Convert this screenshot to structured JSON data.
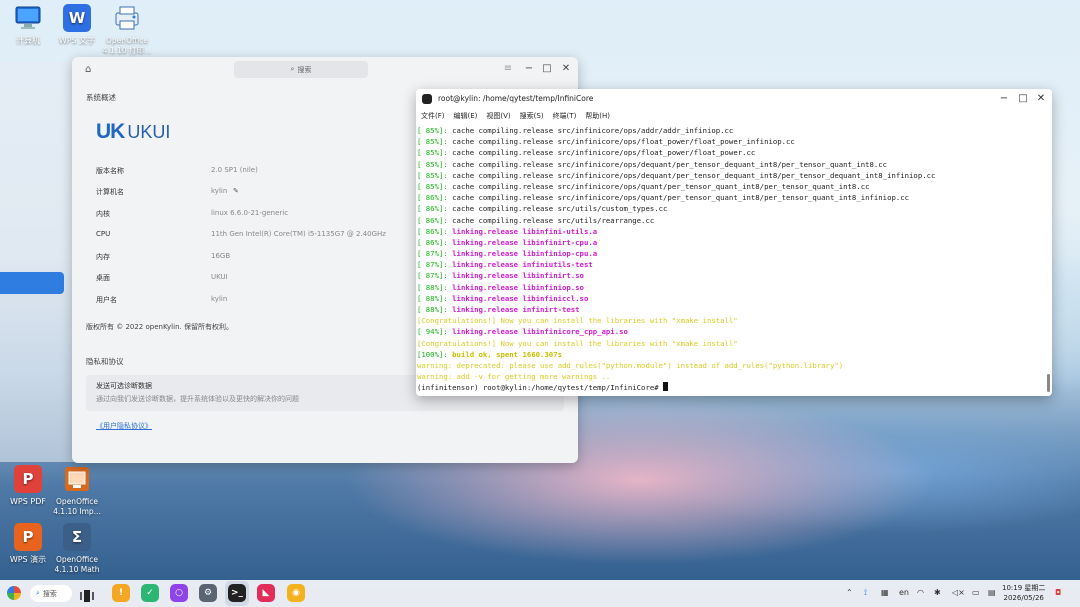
{
  "desktop": {
    "icons_top": [
      {
        "label": "计算机",
        "icon": "computer-icon",
        "color": "#2f7de1"
      },
      {
        "label": "WPS 文字",
        "icon": "wps-writer-icon",
        "color": "#2f6fe4",
        "glyph": "W"
      },
      {
        "label": "OpenOffice 4.1.10 打印...",
        "icon": "openoffice-printer-icon",
        "color": "#3a86d8"
      }
    ],
    "icons_bottom": [
      {
        "label": "WPS PDF",
        "icon": "wps-pdf-icon",
        "color": "#e0423b",
        "glyph": "P"
      },
      {
        "label": "OpenOffice 4.1.10 Imp...",
        "icon": "openoffice-impress-icon",
        "color": "#d86a1e"
      },
      {
        "label": "WPS 演示",
        "icon": "wps-presentation-icon",
        "color": "#e8641e",
        "glyph": "P"
      },
      {
        "label": "OpenOffice 4.1.10 Math",
        "icon": "openoffice-math-icon",
        "color": "#3c5f8a",
        "glyph": "Σ"
      }
    ]
  },
  "settings": {
    "search_placeholder": "搜索",
    "section_overview": "系统概述",
    "logo_mark": "UK",
    "logo_text": "UKUI",
    "rows": [
      {
        "key": "版本名称",
        "value": "2.0 SP1 (nile)"
      },
      {
        "key": "计算机名",
        "value": "kylin"
      },
      {
        "key": "内核",
        "value": "linux 6.6.0-21-generic"
      },
      {
        "key": "CPU",
        "value": "11th Gen Intel(R) Core(TM) i5-1135G7 @ 2.40GHz"
      },
      {
        "key": "内存",
        "value": "16GB"
      },
      {
        "key": "桌面",
        "value": "UKUI"
      },
      {
        "key": "用户名",
        "value": "kylin"
      }
    ],
    "copyright": "版权所有 © 2022 openKylin. 保留所有权利。",
    "section_privacy": "隐私和协议",
    "diag_title": "发送可选诊断数据",
    "diag_desc": "通过向我们发送诊断数据，提升系统体验以及更快的解决你的问题",
    "policy_link": "《用户隐私协议》"
  },
  "terminal": {
    "title": "root@kylin: /home/qytest/temp/InfiniCore",
    "menu": [
      "文件(F)",
      "编辑(E)",
      "视图(V)",
      "搜索(S)",
      "终端(T)",
      "帮助(H)"
    ],
    "lines": [
      {
        "type": "cache",
        "pct": "[ 85%]:",
        "text": " cache compiling.release src/infinicore/ops/addr/addr_infiniop.cc"
      },
      {
        "type": "cache",
        "pct": "[ 85%]:",
        "text": " cache compiling.release src/infinicore/ops/float_power/float_power_infiniop.cc"
      },
      {
        "type": "cache",
        "pct": "[ 85%]:",
        "text": " cache compiling.release src/infinicore/ops/float_power/float_power.cc"
      },
      {
        "type": "cache",
        "pct": "[ 85%]:",
        "text": " cache compiling.release src/infinicore/ops/dequant/per_tensor_dequant_int8/per_tensor_quant_int8.cc"
      },
      {
        "type": "cache",
        "pct": "[ 85%]:",
        "text": " cache compiling.release src/infinicore/ops/dequant/per_tensor_dequant_int8/per_tensor_dequant_int8_infiniop.cc"
      },
      {
        "type": "cache",
        "pct": "[ 85%]:",
        "text": " cache compiling.release src/infinicore/ops/quant/per_tensor_quant_int8/per_tensor_quant_int8.cc"
      },
      {
        "type": "cache",
        "pct": "[ 86%]:",
        "text": " cache compiling.release src/infinicore/ops/quant/per_tensor_quant_int8/per_tensor_quant_int8_infiniop.cc"
      },
      {
        "type": "cache",
        "pct": "[ 86%]:",
        "text": " cache compiling.release src/utils/custom_types.cc"
      },
      {
        "type": "cache",
        "pct": "[ 86%]:",
        "text": " cache compiling.release src/utils/rearrange.cc"
      },
      {
        "type": "link",
        "pct": "[ 86%]:",
        "text": " linking.release libinfini-utils.a"
      },
      {
        "type": "link",
        "pct": "[ 86%]:",
        "text": " linking.release libinfinirt-cpu.a"
      },
      {
        "type": "link",
        "pct": "[ 87%]:",
        "text": " linking.release libinfiniop-cpu.a"
      },
      {
        "type": "link",
        "pct": "[ 87%]:",
        "text": " linking.release infiniutils-test"
      },
      {
        "type": "link",
        "pct": "[ 87%]:",
        "text": " linking.release libinfinirt.so"
      },
      {
        "type": "link",
        "pct": "[ 88%]:",
        "text": " linking.release libinfiniop.so"
      },
      {
        "type": "link",
        "pct": "[ 88%]:",
        "text": " linking.release libinfiniccl.so"
      },
      {
        "type": "link",
        "pct": "[ 88%]:",
        "text": " linking.release infinirt-test"
      },
      {
        "type": "congrats",
        "pct": "",
        "text": "[Congratulations!] Now you can install the libraries with \"xmake install\""
      },
      {
        "type": "link",
        "pct": "[ 94%]:",
        "text": " linking.release libinfinicore_cpp_api.so"
      },
      {
        "type": "congrats",
        "pct": "",
        "text": "[Congratulations!] Now you can install the libraries with \"xmake install\""
      },
      {
        "type": "build",
        "pct": "[100%]:",
        "text": " build ok, spent 1660.307s"
      },
      {
        "type": "warn",
        "pct": "",
        "text": "warning: deprecated: please use add_rules(\"python.module\") instead of add_rules(\"python.library\")"
      },
      {
        "type": "warn",
        "pct": "",
        "text": "warning: add -v for getting more warnings .."
      }
    ],
    "prompt": "(infinitensor) root@kylin:/home/qytest/temp/InfiniCore# "
  },
  "taskbar": {
    "search_label": "搜索",
    "apps": [
      {
        "name": "taskbar-app-notes",
        "color": "#f5a623",
        "glyph": "!"
      },
      {
        "name": "taskbar-app-wechat-work",
        "color": "#2bb673",
        "glyph": "✓"
      },
      {
        "name": "taskbar-app-browser",
        "color": "#8e44e8",
        "glyph": "○"
      },
      {
        "name": "taskbar-app-settings",
        "color": "#5b6472",
        "glyph": "⚙"
      },
      {
        "name": "taskbar-app-terminal",
        "color": "#222222",
        "glyph": ">_"
      },
      {
        "name": "taskbar-app-kylin",
        "color": "#e02d5a",
        "glyph": "◣"
      },
      {
        "name": "taskbar-app-wechat",
        "color": "#f3b21d",
        "glyph": "◉"
      }
    ],
    "ime": "en",
    "time": "10:19 星期二",
    "date": "2026/05/26"
  }
}
